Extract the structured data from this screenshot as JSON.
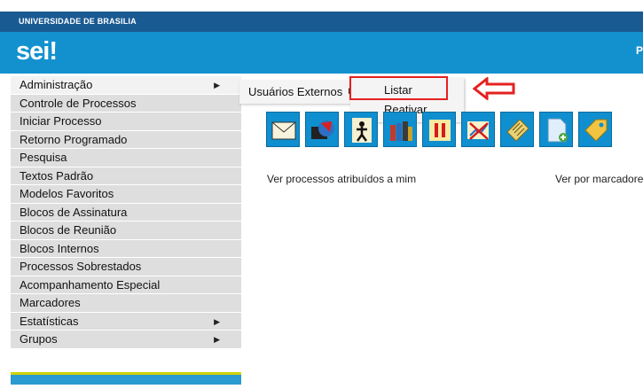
{
  "header": {
    "institution": "UNIVERSIDADE DE BRASILIA",
    "logo": "sei!",
    "right_text": "P"
  },
  "menu": {
    "items": [
      {
        "label": "Administração",
        "has_submenu": true
      },
      {
        "label": "Controle de Processos"
      },
      {
        "label": "Iniciar Processo"
      },
      {
        "label": "Retorno Programado"
      },
      {
        "label": "Pesquisa"
      },
      {
        "label": "Textos Padrão"
      },
      {
        "label": "Modelos Favoritos"
      },
      {
        "label": "Blocos de Assinatura"
      },
      {
        "label": "Blocos de Reunião"
      },
      {
        "label": "Blocos Internos"
      },
      {
        "label": "Processos Sobrestados"
      },
      {
        "label": "Acompanhamento Especial"
      },
      {
        "label": "Marcadores"
      },
      {
        "label": "Estatísticas",
        "has_submenu": true
      },
      {
        "label": "Grupos",
        "has_submenu": true
      }
    ]
  },
  "submenu1": {
    "label": "Usuários Externos"
  },
  "submenu2": {
    "items": [
      {
        "label": "Listar"
      },
      {
        "label": "Reativar"
      }
    ]
  },
  "toolbar": {
    "icons": [
      "email-icon",
      "send-process-icon",
      "assign-user-icon",
      "books-icon",
      "pause-icon",
      "chart-cancel-icon",
      "notes-icon",
      "new-document-icon",
      "tag-icon"
    ]
  },
  "main": {
    "assigned_link": "Ver processos atribuídos a mim",
    "markers_link": "Ver por marcadores"
  },
  "colors": {
    "institution_bar": "#1a5a93",
    "brand_bar": "#1391cf",
    "menu_bg": "#dedede",
    "highlight": "#e52020"
  }
}
